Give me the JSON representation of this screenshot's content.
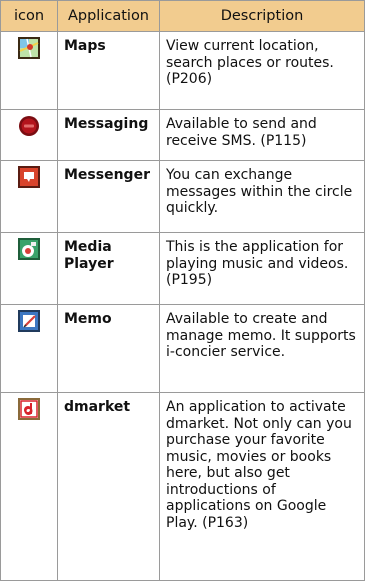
{
  "table": {
    "headers": {
      "icon": "icon",
      "application": "Application",
      "description": "Description"
    },
    "rows": [
      {
        "icon": "maps-icon",
        "name": "Maps",
        "description": "View current location, search places or routes. (P206)"
      },
      {
        "icon": "messaging-icon",
        "name": "Messaging",
        "description": "Available to send and receive SMS. (P115)"
      },
      {
        "icon": "messenger-icon",
        "name": "Messenger",
        "description": "You can exchange messages within the circle quickly."
      },
      {
        "icon": "media-player-icon",
        "name": "Media Player",
        "description": "This is the application for playing music and videos. (P195)"
      },
      {
        "icon": "memo-icon",
        "name": "Memo",
        "description": "Available to create and manage memo. It supports i-concier service."
      },
      {
        "icon": "dmarket-icon",
        "name": "dmarket",
        "description": "An application to activate dmarket. Not only can you purchase your favorite music, movies or books here, but also get introductions of applications on Google Play. (P163)"
      }
    ]
  },
  "colors": {
    "header_bg": "#f2cc8f",
    "grid": "#9a9a9a"
  }
}
